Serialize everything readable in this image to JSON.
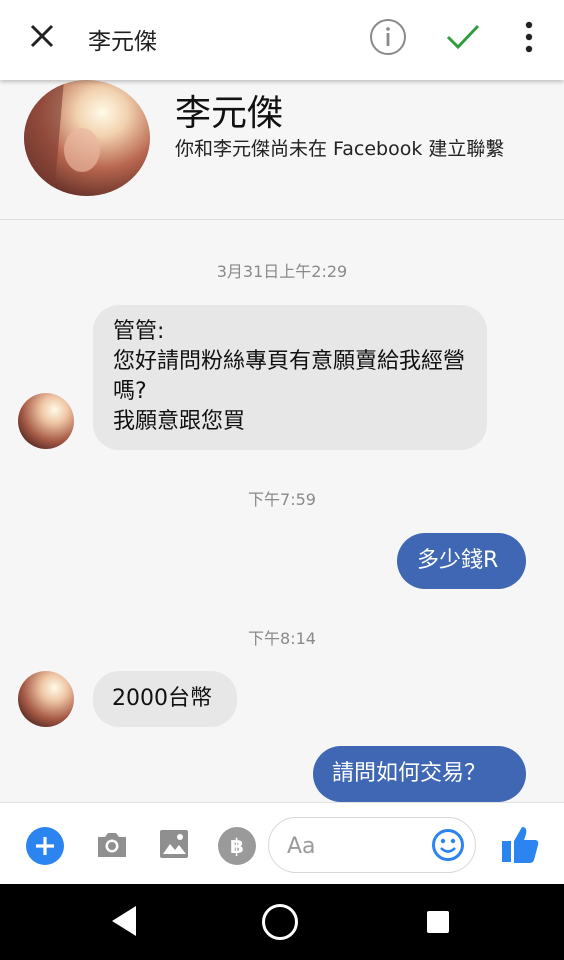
{
  "header": {
    "title": "李元傑",
    "icons": [
      "close-icon",
      "info-icon",
      "checkmark-icon",
      "more-vert-icon"
    ],
    "accent_check": "#2e9c3f"
  },
  "profile": {
    "name": "李元傑",
    "subtitle": "你和李元傑尚未在 Facebook 建立聯繫"
  },
  "messages": {
    "t1": "3月31日上午2:29",
    "m1": "管管:\n您好請問粉絲專頁有意願賣給我經營嗎?\n我願意跟您買",
    "t2": "下午7:59",
    "m2": "多少錢R",
    "t3": "下午8:14",
    "m3": "2000台幣",
    "m4": "請問如何交易？"
  },
  "composer": {
    "placeholder": "Aa",
    "pay_symbol": "฿",
    "icons": [
      "plus-icon",
      "camera-icon",
      "image-icon",
      "payment-icon",
      "emoji-icon",
      "like-icon"
    ],
    "accent": "#2b84f0"
  },
  "colors": {
    "outgoing_bubble": "#3f67b4",
    "incoming_bubble": "#e7e7e7"
  }
}
